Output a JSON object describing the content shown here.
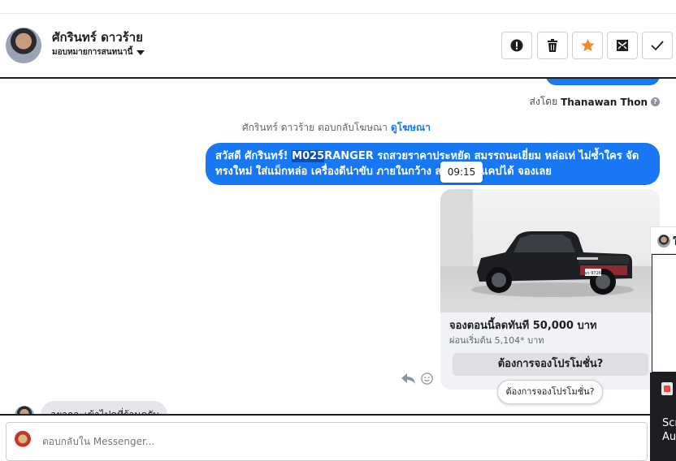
{
  "header": {
    "contact_name": "ศักรินทร์ ดาวร้าย",
    "assign_label": "มอบหมายการสนทนานี้",
    "actions": {
      "alert_icon": "exclamation-icon",
      "delete_icon": "trash-icon",
      "star_icon": "star-icon",
      "archive_icon": "archive-icon",
      "done_icon": "check-icon"
    },
    "star_color": "#f28b22"
  },
  "thread": {
    "sent_by_prefix": "ส่งโดย",
    "sent_by_name": "Thanawan Thon",
    "ad_reply_text": "ศักรินทร์ ดาวร้าย ตอบกลับโฆษณา",
    "ad_link": "ดูโฆษณา",
    "message": {
      "greeting": "สวัสดี ศักรินทร์! ",
      "highlighted": "M025",
      "line1_rest": "RANGER รถสวยราคาประหยัด สมรรถนะเยี่ยม หล่อเท่ ไม่ซ้ำใคร จัด",
      "line2": "ทรงใหม่ ใส่แม็กหล่อ เครื่องดีน่าขับ ภายในกว้าง สบาย   เปิดแคปได้ จองเลย",
      "time_tooltip": "09:15"
    },
    "card": {
      "title": "จองตอนนี้ลดทันที  50,000 บาท",
      "subtitle": "ผ่อนเริ่มต้น 5,104* บาท",
      "button_label": "ต้องการจองโปรโมชั่น?",
      "plate_text": "ผร 9726"
    },
    "received_message": "อยากจะเข้าไปดูที่ร้านครับ",
    "quick_reply_label": "ต้องการจองโปรโมชั่น?"
  },
  "composer": {
    "placeholder": "ตอบกลับใน Messenger..."
  },
  "side_panel": {
    "top_letter": "ใ",
    "dark_text_line1": "Scr",
    "dark_text_line2": "Au"
  },
  "colors": {
    "brand_blue": "#1877f2",
    "text_dark": "#1c1e21",
    "muted": "#606770"
  }
}
